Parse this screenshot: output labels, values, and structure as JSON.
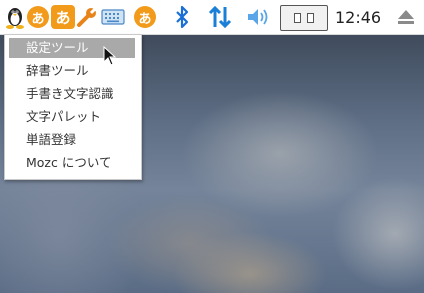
{
  "taskbar": {
    "ime_glyph": "あ",
    "clock": "12:46",
    "icons": [
      "tux-icon",
      "ime-hiragana-icon",
      "ime-hiragana-icon",
      "wrench-icon",
      "keyboard-icon",
      "ime-hiragana-icon",
      "bluetooth-icon",
      "network-arrows-icon",
      "volume-icon",
      "workspace-switcher-icon",
      "eject-icon"
    ]
  },
  "menu": {
    "items": [
      {
        "label": "設定ツール",
        "selected": true
      },
      {
        "label": "辞書ツール"
      },
      {
        "label": "手書き文字認識"
      },
      {
        "label": "文字パレット"
      },
      {
        "label": "単語登録"
      },
      {
        "label": "Mozc について"
      }
    ]
  },
  "colors": {
    "accent_orange": "#f29a1a",
    "bluetooth_blue": "#1a6fd6",
    "menu_selected": "#a9a9a9"
  }
}
